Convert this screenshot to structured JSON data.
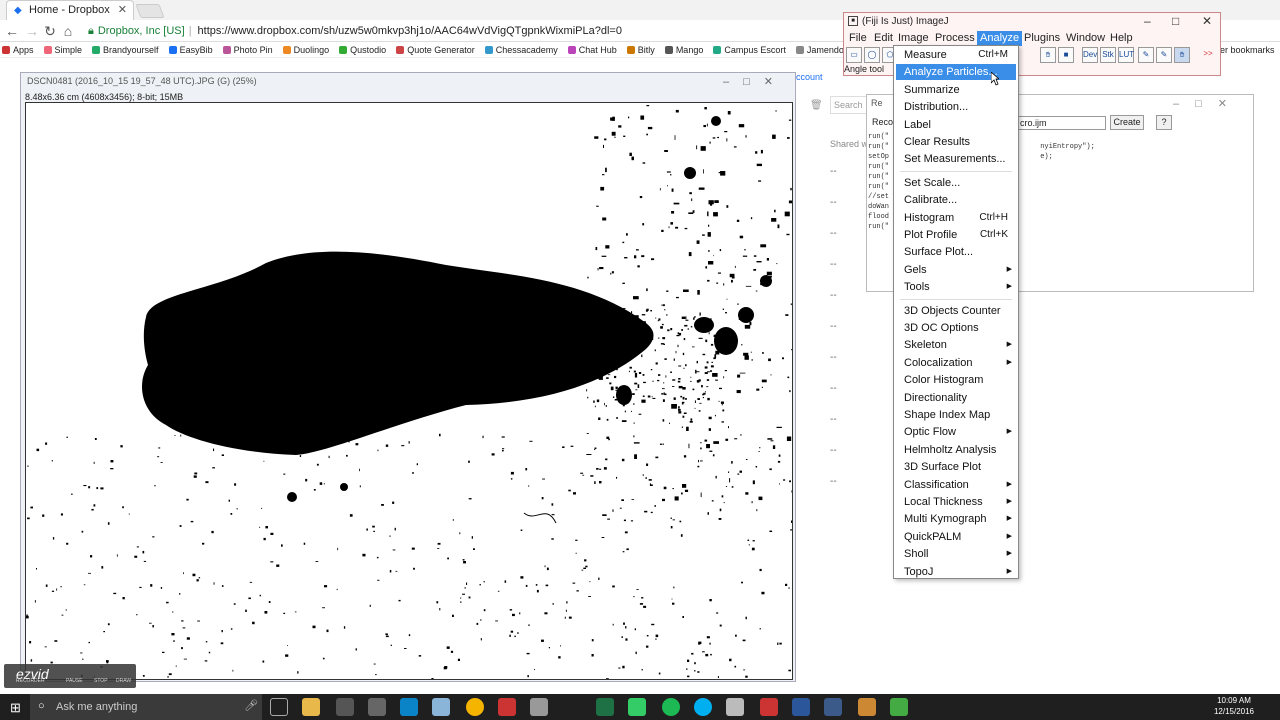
{
  "browser": {
    "tab_title": "Home - Dropbox",
    "secure_label": "Dropbox, Inc [US]",
    "url": "https://www.dropbox.com/sh/uzw5w0mkvp3hj1o/AAC64wVdVigQTgpnkWixmiPLa?dl=0",
    "bookmarks": [
      "Apps",
      "Simple",
      "Brandyourself",
      "EasyBib",
      "Photo Pin",
      "Duolingo",
      "Qustodio",
      "Quote Generator",
      "Chessacademy",
      "Chat Hub",
      "Bitly",
      "Mango",
      "Campus Escort",
      "Jamendo Music | Free"
    ],
    "other_bookmarks": "er bookmarks"
  },
  "dropbox": {
    "account": "ccount",
    "search": "Search",
    "shared_col": "Shared w",
    "dash": "--"
  },
  "image_window": {
    "title": "DSCN0481 (2016_10_15 19_57_48 UTC).JPG (G) (25%)",
    "info": "8.48x6.36 cm (4608x3456); 8-bit; 15MB"
  },
  "fiji": {
    "title": "(Fiji Is Just) ImageJ",
    "menus": [
      "File",
      "Edit",
      "Image",
      "Process",
      "Analyze",
      "Plugins",
      "Window",
      "Help"
    ],
    "active_menu": "Analyze",
    "status": "Angle tool",
    "tools": [
      "Dev",
      "Stk",
      "LUT"
    ],
    "more": ">>"
  },
  "recorder": {
    "title": "Re",
    "record_label": "Recor",
    "filename": "cro.ijm",
    "create": "Create",
    "help": "?",
    "code": "run(\"\nrun(\"                                    nyiEntropy\");\nsetOp                                    e);\nrun(\"\nrun(\"\nrun(\"\n//set\ndoWan\nflood\nrun(\""
  },
  "analyze_menu": [
    {
      "label": "Measure",
      "shortcut": "Ctrl+M"
    },
    {
      "label": "Analyze Particles...",
      "highlight": true
    },
    {
      "label": "Summarize"
    },
    {
      "label": "Distribution..."
    },
    {
      "label": "Label"
    },
    {
      "label": "Clear Results"
    },
    {
      "label": "Set Measurements...",
      "sep_after": true
    },
    {
      "label": "Set Scale..."
    },
    {
      "label": "Calibrate..."
    },
    {
      "label": "Histogram",
      "shortcut": "Ctrl+H"
    },
    {
      "label": "Plot Profile",
      "shortcut": "Ctrl+K"
    },
    {
      "label": "Surface Plot..."
    },
    {
      "label": "Gels",
      "submenu": true
    },
    {
      "label": "Tools",
      "submenu": true,
      "sep_after": true
    },
    {
      "label": "3D Objects Counter"
    },
    {
      "label": "3D OC Options"
    },
    {
      "label": "Skeleton",
      "submenu": true
    },
    {
      "label": "Colocalization",
      "submenu": true
    },
    {
      "label": "Color Histogram"
    },
    {
      "label": "Directionality"
    },
    {
      "label": "Shape Index Map"
    },
    {
      "label": "Optic Flow",
      "submenu": true
    },
    {
      "label": "Helmholtz Analysis"
    },
    {
      "label": "3D Surface Plot"
    },
    {
      "label": "Classification",
      "submenu": true
    },
    {
      "label": "Local Thickness",
      "submenu": true
    },
    {
      "label": "Multi Kymograph",
      "submenu": true
    },
    {
      "label": "QuickPALM",
      "submenu": true
    },
    {
      "label": "Sholl",
      "submenu": true
    },
    {
      "label": "TopoJ",
      "submenu": true
    }
  ],
  "ezvid": {
    "logo": "ezvid",
    "pause": "PAUSE",
    "stop": "STOP",
    "draw": "DRAW",
    "sub": "RECORDER"
  },
  "taskbar": {
    "search": "Ask me anything",
    "time": "10:09 AM",
    "date": "12/15/2016"
  },
  "colors": {
    "highlight": "#3b8ee8",
    "taskbar": "#1f1f1f"
  }
}
